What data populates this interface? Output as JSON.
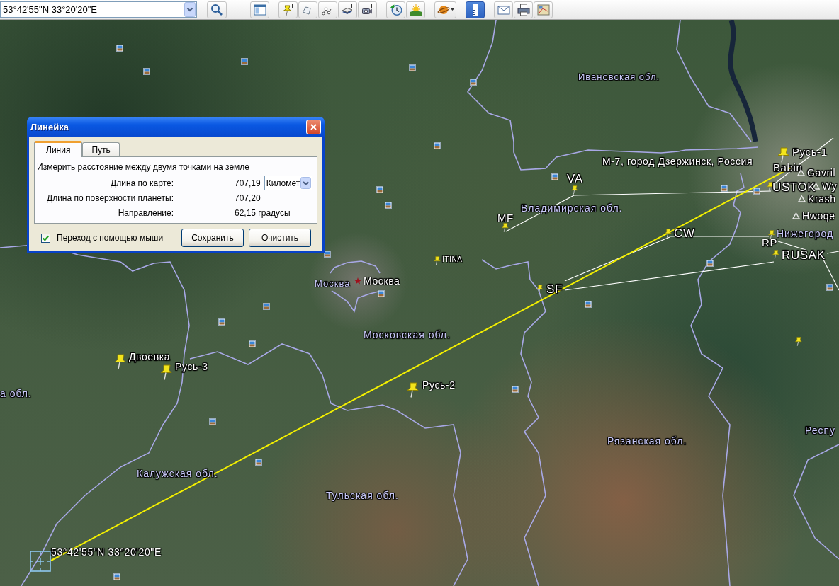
{
  "toolbar": {
    "search_field": {
      "value": "53°42'55\"N 33°20'20\"E"
    },
    "tool_groups": [
      {
        "tools": [
          {
            "kind": "sidebar",
            "selected": false
          }
        ]
      },
      {
        "tools": [
          {
            "kind": "placemark",
            "selected": false
          },
          {
            "kind": "polygon",
            "selected": false
          },
          {
            "kind": "path",
            "selected": false
          },
          {
            "kind": "overlay",
            "selected": false
          },
          {
            "kind": "tour",
            "selected": false
          }
        ]
      },
      {
        "tools": [
          {
            "kind": "history",
            "selected": false
          },
          {
            "kind": "sun",
            "selected": false
          }
        ]
      },
      {
        "tools": [
          {
            "kind": "planets",
            "selected": false
          }
        ]
      },
      {
        "tools": [
          {
            "kind": "ruler",
            "selected": true
          }
        ]
      },
      {
        "tools": [
          {
            "kind": "email",
            "selected": false
          },
          {
            "kind": "print",
            "selected": false
          },
          {
            "kind": "maps",
            "selected": false
          }
        ]
      }
    ]
  },
  "map": {
    "labels": [
      {
        "kind": "region",
        "text": "Ивановская обл."
      },
      {
        "kind": "place",
        "text": "М-7, город Дзержинск, Россия"
      },
      {
        "kind": "place",
        "text": "Babin"
      },
      {
        "kind": "peak",
        "text": "Gavril"
      },
      {
        "kind": "peak",
        "text": "Wy"
      },
      {
        "kind": "peak",
        "text": "Krash"
      },
      {
        "kind": "peak",
        "text": "Hwoqe"
      },
      {
        "kind": "region",
        "text": "Нижегород"
      },
      {
        "kind": "region",
        "text": "Владимирская обл."
      },
      {
        "kind": "region",
        "text": "Москва"
      },
      {
        "kind": "city",
        "text": "Москва"
      },
      {
        "kind": "region",
        "text": "Московская обл."
      },
      {
        "kind": "region",
        "text": "а обл."
      },
      {
        "kind": "region",
        "text": "Респу"
      },
      {
        "kind": "region",
        "text": "Рязанская обл."
      },
      {
        "kind": "region",
        "text": "Калужская обл."
      },
      {
        "kind": "region",
        "text": "Тульская обл."
      }
    ],
    "placemarks": [
      {
        "label": "Русь-1"
      },
      {
        "label": "USTOK"
      },
      {
        "label": "VA"
      },
      {
        "label": "MF"
      },
      {
        "label": "CW"
      },
      {
        "label": "RP"
      },
      {
        "label": "RUSAK"
      },
      {
        "label": "ITINA"
      },
      {
        "label": "SF"
      },
      {
        "label": "Двоевка"
      },
      {
        "label": "Русь-3"
      },
      {
        "label": "Русь-2"
      }
    ],
    "ruler_readout": "53°42'55\"N 33°20'20\"E"
  },
  "dialog": {
    "title": "Линейка",
    "tabs": [
      {
        "label": "Линия",
        "selected": true
      },
      {
        "label": "Путь",
        "selected": false
      }
    ],
    "description": "Измерить расстояние между двумя точками на земле",
    "rows": [
      {
        "label": "Длина по карте:",
        "value": "707,19",
        "unit": "Километ"
      },
      {
        "label": "Длина по поверхности планеты:",
        "value": "707,20"
      },
      {
        "label": "Направление:",
        "value": "62,15 градусы"
      }
    ],
    "checkbox": {
      "label": "Переход с помощью мыши",
      "checked": true
    },
    "buttons": [
      "Сохранить",
      "Очистить"
    ]
  }
}
